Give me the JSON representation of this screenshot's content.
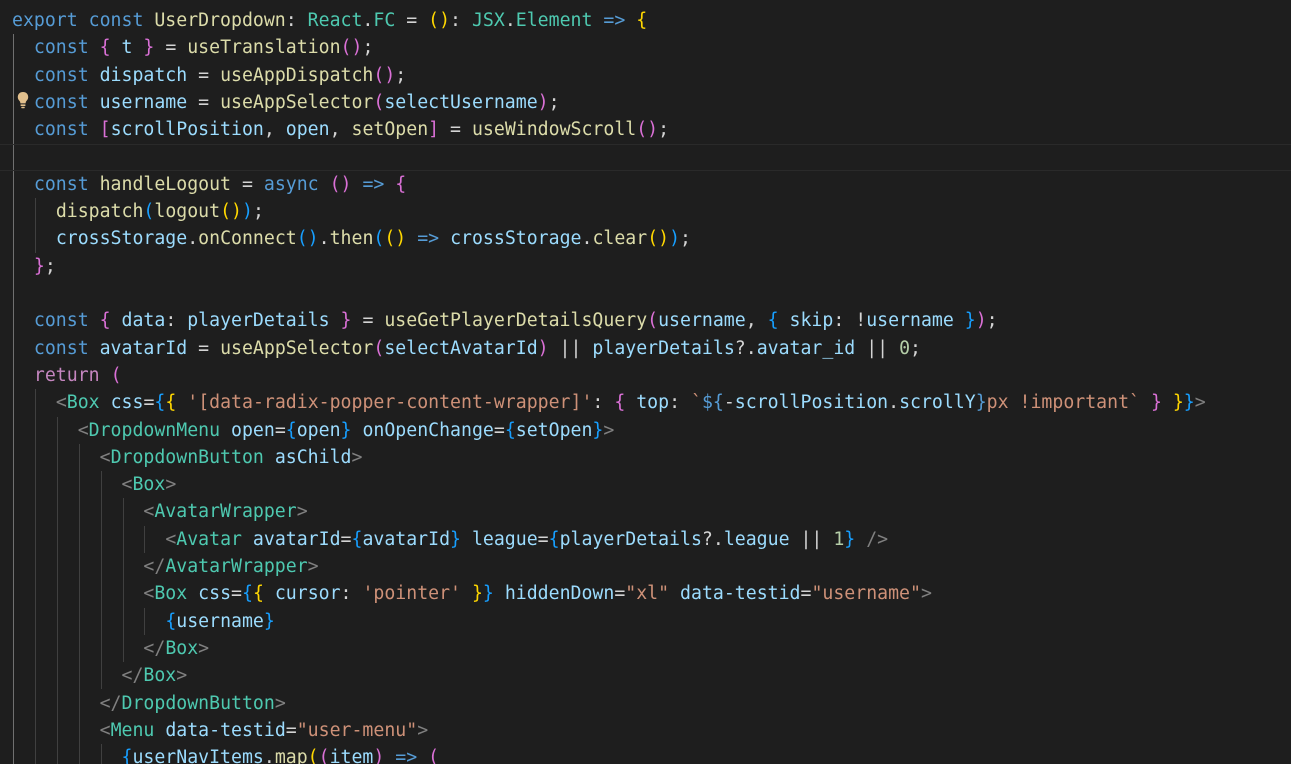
{
  "editor": {
    "theme_colors": {
      "background": "#1e1e1e",
      "keyword": "#569cd6",
      "control": "#c586c0",
      "function": "#dcdcaa",
      "type": "#4ec9b0",
      "variable": "#9cdcfe",
      "string": "#ce9178",
      "number": "#b5cea8",
      "bracket_1": "#ffd700",
      "bracket_2": "#da70d6",
      "bracket_3": "#179fff"
    },
    "gutter_icon": "lightbulb-icon",
    "current_line": 5,
    "lines": [
      [
        [
          "kw",
          "export"
        ],
        [
          "pun",
          " "
        ],
        [
          "kw",
          "const"
        ],
        [
          "pun",
          " "
        ],
        [
          "fn",
          "UserDropdown"
        ],
        [
          "pun",
          ": "
        ],
        [
          "ty",
          "React"
        ],
        [
          "pun",
          "."
        ],
        [
          "ty",
          "FC"
        ],
        [
          "pun",
          " = "
        ],
        [
          "b1",
          "()"
        ],
        [
          "pun",
          ": "
        ],
        [
          "ty",
          "JSX"
        ],
        [
          "pun",
          "."
        ],
        [
          "ty",
          "Element"
        ],
        [
          "pun",
          " "
        ],
        [
          "kw",
          "=>"
        ],
        [
          "pun",
          " "
        ],
        [
          "b1",
          "{"
        ]
      ],
      [
        [
          "pun",
          "  "
        ],
        [
          "kw",
          "const"
        ],
        [
          "pun",
          " "
        ],
        [
          "b2",
          "{"
        ],
        [
          "pun",
          " "
        ],
        [
          "var",
          "t"
        ],
        [
          "pun",
          " "
        ],
        [
          "b2",
          "}"
        ],
        [
          "pun",
          " = "
        ],
        [
          "fn",
          "useTranslation"
        ],
        [
          "b2",
          "()"
        ],
        [
          "pun",
          ";"
        ]
      ],
      [
        [
          "pun",
          "  "
        ],
        [
          "kw",
          "const"
        ],
        [
          "pun",
          " "
        ],
        [
          "var",
          "dispatch"
        ],
        [
          "pun",
          " = "
        ],
        [
          "fn",
          "useAppDispatch"
        ],
        [
          "b2",
          "()"
        ],
        [
          "pun",
          ";"
        ]
      ],
      [
        [
          "pun",
          "  "
        ],
        [
          "kw",
          "const"
        ],
        [
          "pun",
          " "
        ],
        [
          "var",
          "username"
        ],
        [
          "pun",
          " = "
        ],
        [
          "fn",
          "useAppSelector"
        ],
        [
          "b2",
          "("
        ],
        [
          "var",
          "selectUsername"
        ],
        [
          "b2",
          ")"
        ],
        [
          "pun",
          ";"
        ]
      ],
      [
        [
          "pun",
          "  "
        ],
        [
          "kw",
          "const"
        ],
        [
          "pun",
          " "
        ],
        [
          "b2",
          "["
        ],
        [
          "var",
          "scrollPosition"
        ],
        [
          "pun",
          ", "
        ],
        [
          "var",
          "open"
        ],
        [
          "pun",
          ", "
        ],
        [
          "fn",
          "setOpen"
        ],
        [
          "b2",
          "]"
        ],
        [
          "pun",
          " = "
        ],
        [
          "fn",
          "useWindowScroll"
        ],
        [
          "b2",
          "()"
        ],
        [
          "pun",
          ";"
        ]
      ],
      [],
      [
        [
          "pun",
          "  "
        ],
        [
          "kw",
          "const"
        ],
        [
          "pun",
          " "
        ],
        [
          "fn",
          "handleLogout"
        ],
        [
          "pun",
          " = "
        ],
        [
          "kw",
          "async"
        ],
        [
          "pun",
          " "
        ],
        [
          "b2",
          "()"
        ],
        [
          "pun",
          " "
        ],
        [
          "kw",
          "=>"
        ],
        [
          "pun",
          " "
        ],
        [
          "b2",
          "{"
        ]
      ],
      [
        [
          "pun",
          "    "
        ],
        [
          "fn",
          "dispatch"
        ],
        [
          "b3",
          "("
        ],
        [
          "fn",
          "logout"
        ],
        [
          "b1",
          "()"
        ],
        [
          "b3",
          ")"
        ],
        [
          "pun",
          ";"
        ]
      ],
      [
        [
          "pun",
          "    "
        ],
        [
          "var",
          "crossStorage"
        ],
        [
          "pun",
          "."
        ],
        [
          "fn",
          "onConnect"
        ],
        [
          "b3",
          "()"
        ],
        [
          "pun",
          "."
        ],
        [
          "fn",
          "then"
        ],
        [
          "b3",
          "("
        ],
        [
          "b1",
          "()"
        ],
        [
          "pun",
          " "
        ],
        [
          "kw",
          "=>"
        ],
        [
          "pun",
          " "
        ],
        [
          "var",
          "crossStorage"
        ],
        [
          "pun",
          "."
        ],
        [
          "fn",
          "clear"
        ],
        [
          "b1",
          "()"
        ],
        [
          "b3",
          ")"
        ],
        [
          "pun",
          ";"
        ]
      ],
      [
        [
          "pun",
          "  "
        ],
        [
          "b2",
          "}"
        ],
        [
          "pun",
          ";"
        ]
      ],
      [],
      [
        [
          "pun",
          "  "
        ],
        [
          "kw",
          "const"
        ],
        [
          "pun",
          " "
        ],
        [
          "b2",
          "{"
        ],
        [
          "pun",
          " "
        ],
        [
          "var",
          "data"
        ],
        [
          "pun",
          ": "
        ],
        [
          "var",
          "playerDetails"
        ],
        [
          "pun",
          " "
        ],
        [
          "b2",
          "}"
        ],
        [
          "pun",
          " = "
        ],
        [
          "fn",
          "useGetPlayerDetailsQuery"
        ],
        [
          "b2",
          "("
        ],
        [
          "var",
          "username"
        ],
        [
          "pun",
          ", "
        ],
        [
          "b3",
          "{"
        ],
        [
          "pun",
          " "
        ],
        [
          "var",
          "skip"
        ],
        [
          "pun",
          ": !"
        ],
        [
          "var",
          "username"
        ],
        [
          "pun",
          " "
        ],
        [
          "b3",
          "}"
        ],
        [
          "b2",
          ")"
        ],
        [
          "pun",
          ";"
        ]
      ],
      [
        [
          "pun",
          "  "
        ],
        [
          "kw",
          "const"
        ],
        [
          "pun",
          " "
        ],
        [
          "var",
          "avatarId"
        ],
        [
          "pun",
          " = "
        ],
        [
          "fn",
          "useAppSelector"
        ],
        [
          "b2",
          "("
        ],
        [
          "var",
          "selectAvatarId"
        ],
        [
          "b2",
          ")"
        ],
        [
          "pun",
          " || "
        ],
        [
          "var",
          "playerDetails"
        ],
        [
          "pun",
          "?."
        ],
        [
          "var",
          "avatar_id"
        ],
        [
          "pun",
          " || "
        ],
        [
          "num",
          "0"
        ],
        [
          "pun",
          ";"
        ]
      ],
      [
        [
          "pun",
          "  "
        ],
        [
          "kwc",
          "return"
        ],
        [
          "pun",
          " "
        ],
        [
          "b2",
          "("
        ]
      ],
      [
        [
          "pun",
          "    "
        ],
        [
          "tag",
          "<"
        ],
        [
          "ty",
          "Box"
        ],
        [
          "pun",
          " "
        ],
        [
          "var",
          "css"
        ],
        [
          "pun",
          "="
        ],
        [
          "b3",
          "{"
        ],
        [
          "b1",
          "{"
        ],
        [
          "pun",
          " "
        ],
        [
          "str",
          "'[data-radix-popper-content-wrapper]'"
        ],
        [
          "pun",
          ": "
        ],
        [
          "b2",
          "{"
        ],
        [
          "pun",
          " "
        ],
        [
          "var",
          "top"
        ],
        [
          "pun",
          ": "
        ],
        [
          "str",
          "`"
        ],
        [
          "kw",
          "${"
        ],
        [
          "pun",
          "-"
        ],
        [
          "var",
          "scrollPosition"
        ],
        [
          "pun",
          "."
        ],
        [
          "var",
          "scrollY"
        ],
        [
          "kw",
          "}"
        ],
        [
          "str",
          "px !important`"
        ],
        [
          "pun",
          " "
        ],
        [
          "b2",
          "}"
        ],
        [
          "pun",
          " "
        ],
        [
          "b1",
          "}"
        ],
        [
          "b3",
          "}"
        ],
        [
          "tag",
          ">"
        ]
      ],
      [
        [
          "pun",
          "      "
        ],
        [
          "tag",
          "<"
        ],
        [
          "ty",
          "DropdownMenu"
        ],
        [
          "pun",
          " "
        ],
        [
          "var",
          "open"
        ],
        [
          "pun",
          "="
        ],
        [
          "b3",
          "{"
        ],
        [
          "var",
          "open"
        ],
        [
          "b3",
          "}"
        ],
        [
          "pun",
          " "
        ],
        [
          "var",
          "onOpenChange"
        ],
        [
          "pun",
          "="
        ],
        [
          "b3",
          "{"
        ],
        [
          "var",
          "setOpen"
        ],
        [
          "b3",
          "}"
        ],
        [
          "tag",
          ">"
        ]
      ],
      [
        [
          "pun",
          "        "
        ],
        [
          "tag",
          "<"
        ],
        [
          "ty",
          "DropdownButton"
        ],
        [
          "pun",
          " "
        ],
        [
          "var",
          "asChild"
        ],
        [
          "tag",
          ">"
        ]
      ],
      [
        [
          "pun",
          "          "
        ],
        [
          "tag",
          "<"
        ],
        [
          "ty",
          "Box"
        ],
        [
          "tag",
          ">"
        ]
      ],
      [
        [
          "pun",
          "            "
        ],
        [
          "tag",
          "<"
        ],
        [
          "ty",
          "AvatarWrapper"
        ],
        [
          "tag",
          ">"
        ]
      ],
      [
        [
          "pun",
          "              "
        ],
        [
          "tag",
          "<"
        ],
        [
          "ty",
          "Avatar"
        ],
        [
          "pun",
          " "
        ],
        [
          "var",
          "avatarId"
        ],
        [
          "pun",
          "="
        ],
        [
          "b3",
          "{"
        ],
        [
          "var",
          "avatarId"
        ],
        [
          "b3",
          "}"
        ],
        [
          "pun",
          " "
        ],
        [
          "var",
          "league"
        ],
        [
          "pun",
          "="
        ],
        [
          "b3",
          "{"
        ],
        [
          "var",
          "playerDetails"
        ],
        [
          "pun",
          "?."
        ],
        [
          "var",
          "league"
        ],
        [
          "pun",
          " || "
        ],
        [
          "num",
          "1"
        ],
        [
          "b3",
          "}"
        ],
        [
          "pun",
          " "
        ],
        [
          "tag",
          "/>"
        ]
      ],
      [
        [
          "pun",
          "            "
        ],
        [
          "tag",
          "</"
        ],
        [
          "ty",
          "AvatarWrapper"
        ],
        [
          "tag",
          ">"
        ]
      ],
      [
        [
          "pun",
          "            "
        ],
        [
          "tag",
          "<"
        ],
        [
          "ty",
          "Box"
        ],
        [
          "pun",
          " "
        ],
        [
          "var",
          "css"
        ],
        [
          "pun",
          "="
        ],
        [
          "b3",
          "{"
        ],
        [
          "b1",
          "{"
        ],
        [
          "pun",
          " "
        ],
        [
          "var",
          "cursor"
        ],
        [
          "pun",
          ": "
        ],
        [
          "str",
          "'pointer'"
        ],
        [
          "pun",
          " "
        ],
        [
          "b1",
          "}"
        ],
        [
          "b3",
          "}"
        ],
        [
          "pun",
          " "
        ],
        [
          "var",
          "hiddenDown"
        ],
        [
          "pun",
          "="
        ],
        [
          "str",
          "\"xl\""
        ],
        [
          "pun",
          " "
        ],
        [
          "var",
          "data-testid"
        ],
        [
          "pun",
          "="
        ],
        [
          "str",
          "\"username\""
        ],
        [
          "tag",
          ">"
        ]
      ],
      [
        [
          "pun",
          "              "
        ],
        [
          "b3",
          "{"
        ],
        [
          "var",
          "username"
        ],
        [
          "b3",
          "}"
        ]
      ],
      [
        [
          "pun",
          "            "
        ],
        [
          "tag",
          "</"
        ],
        [
          "ty",
          "Box"
        ],
        [
          "tag",
          ">"
        ]
      ],
      [
        [
          "pun",
          "          "
        ],
        [
          "tag",
          "</"
        ],
        [
          "ty",
          "Box"
        ],
        [
          "tag",
          ">"
        ]
      ],
      [
        [
          "pun",
          "        "
        ],
        [
          "tag",
          "</"
        ],
        [
          "ty",
          "DropdownButton"
        ],
        [
          "tag",
          ">"
        ]
      ],
      [
        [
          "pun",
          "        "
        ],
        [
          "tag",
          "<"
        ],
        [
          "ty",
          "Menu"
        ],
        [
          "pun",
          " "
        ],
        [
          "var",
          "data-testid"
        ],
        [
          "pun",
          "="
        ],
        [
          "str",
          "\"user-menu\""
        ],
        [
          "tag",
          ">"
        ]
      ],
      [
        [
          "pun",
          "          "
        ],
        [
          "b3",
          "{"
        ],
        [
          "var",
          "userNavItems"
        ],
        [
          "pun",
          "."
        ],
        [
          "fn",
          "map"
        ],
        [
          "b1",
          "("
        ],
        [
          "b2",
          "("
        ],
        [
          "var",
          "item"
        ],
        [
          "b2",
          ")"
        ],
        [
          "pun",
          " "
        ],
        [
          "kw",
          "=>"
        ],
        [
          "pun",
          " "
        ],
        [
          "b2",
          "("
        ]
      ]
    ]
  }
}
